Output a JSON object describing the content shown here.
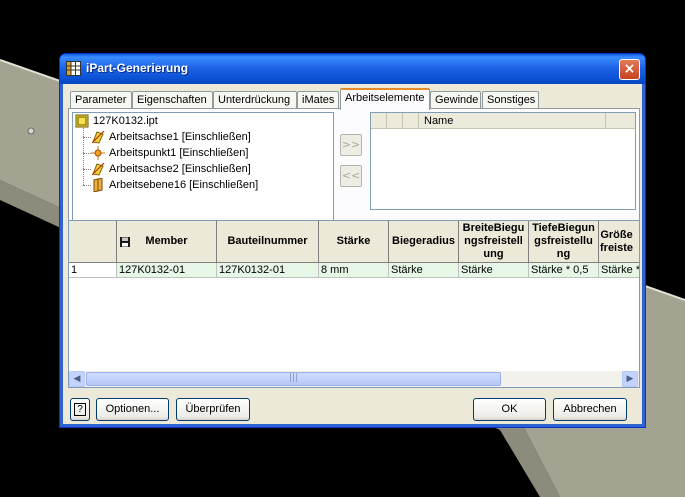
{
  "window": {
    "title": "iPart-Generierung",
    "close_glyph": "×"
  },
  "tabs": [
    {
      "label": "Parameter",
      "active": false
    },
    {
      "label": "Eigenschaften",
      "active": false
    },
    {
      "label": "Unterdrückung",
      "active": false
    },
    {
      "label": "iMates",
      "active": false
    },
    {
      "label": "Arbeitselemente",
      "active": true
    },
    {
      "label": "Gewinde",
      "active": false
    },
    {
      "label": "Sonstiges",
      "active": false
    }
  ],
  "tree": {
    "root": {
      "label": "127K0132.ipt",
      "icon": "part-file-icon"
    },
    "items": [
      {
        "label": "Arbeitsachse1 [Einschließen]",
        "icon": "work-axis-icon"
      },
      {
        "label": "Arbeitspunkt1 [Einschließen]",
        "icon": "work-point-icon"
      },
      {
        "label": "Arbeitsachse2 [Einschließen]",
        "icon": "work-axis-icon"
      },
      {
        "label": "Arbeitsebene16 [Einschließen]",
        "icon": "work-plane-icon"
      }
    ]
  },
  "transfer": {
    "add_label": ">>",
    "remove_label": "<<"
  },
  "list": {
    "name_header": "Name"
  },
  "grid": {
    "headers": [
      "Member",
      "Bauteilnummer",
      "Stärke",
      "Biegeradius",
      "BreiteBiegungsfreistellung",
      "TiefeBiegungsfreistellung",
      "Größefreiste"
    ],
    "header_display": [
      "Member",
      "Bauteilnummer",
      "Stärke",
      "Biegeradius",
      "BreiteBiegu\nngsfreistell\nung",
      "TiefeBiegun\ngsfreistellu\nng",
      "Größe\nfreiste"
    ],
    "rows": [
      {
        "num": "1",
        "cells": [
          "127K0132-01",
          "127K0132-01",
          "8 mm",
          "Stärke",
          "Stärke",
          "Stärke * 0,5",
          "Stärke *"
        ]
      }
    ],
    "scroll_grip": "|||"
  },
  "buttons": {
    "help": "?",
    "options": "Optionen...",
    "verify": "Überprüfen",
    "ok": "OK",
    "cancel": "Abbrechen"
  },
  "colors": {
    "title_bar": "#0a52d6",
    "row_highlight": "#e6f7e6",
    "active_tab_accent": "#e68b2c"
  }
}
